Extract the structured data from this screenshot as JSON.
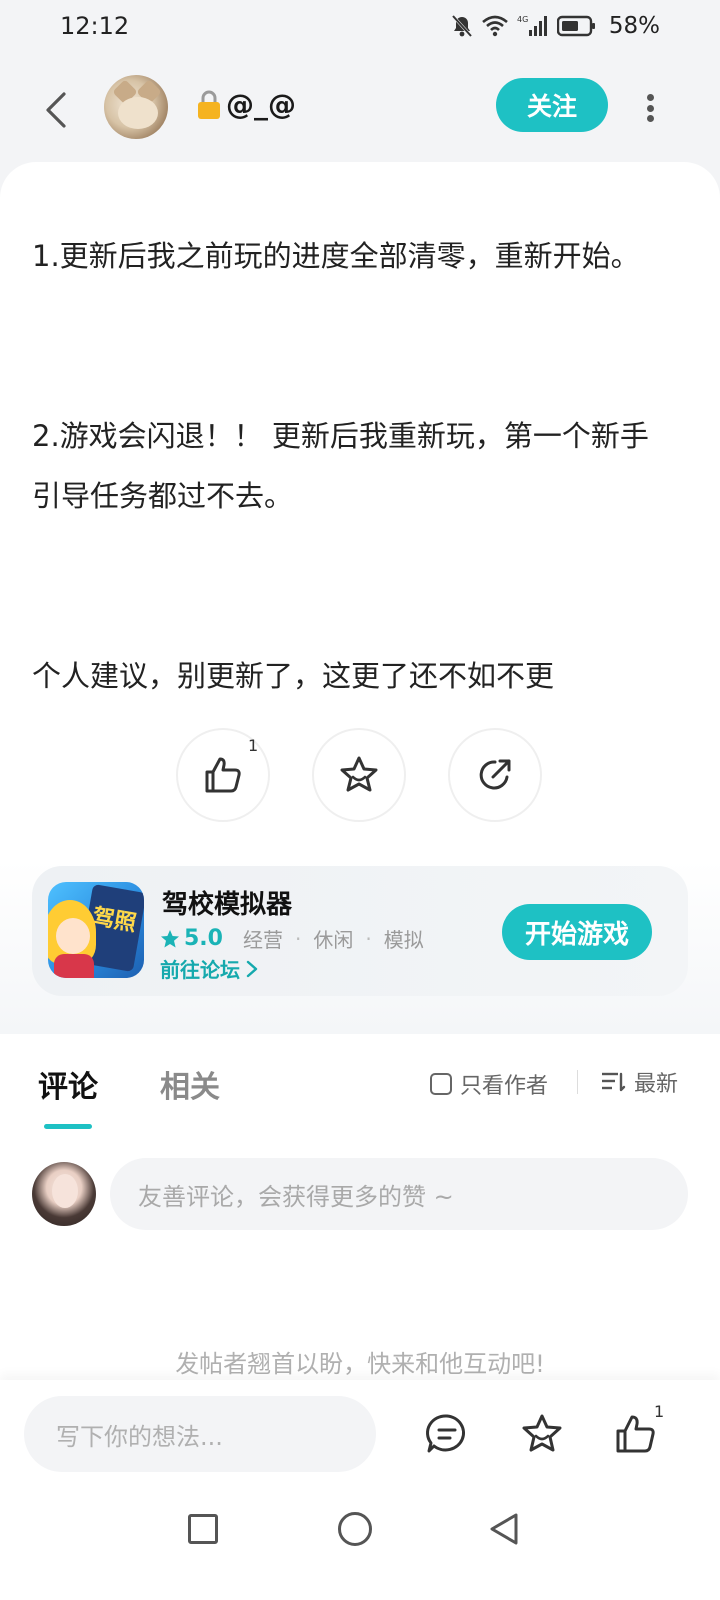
{
  "status_bar": {
    "time": "12:12",
    "battery": "58%"
  },
  "header": {
    "username": "@_@",
    "follow_label": "关注"
  },
  "post": {
    "paragraphs": [
      "1.更新后我之前玩的进度全部清零，重新开始。",
      "2.游戏会闪退！！ 更新后我重新玩，第一个新手引导任务都过不去。",
      "个人建议，别更新了，这更了还不如不更"
    ],
    "like_count": "1"
  },
  "game": {
    "name": "驾校模拟器",
    "rating": "5.0",
    "tags": [
      "经营",
      "休闲",
      "模拟"
    ],
    "forum_link": "前往论坛",
    "play_label": "开始游戏",
    "icon_text": "驾照"
  },
  "comments": {
    "tabs": [
      "评论",
      "相关"
    ],
    "only_author": "只看作者",
    "sort_label": "最新",
    "input_placeholder": "友善评论，会获得更多的赞 ~",
    "empty_hint": "发帖者翘首以盼，快来和他互动吧!"
  },
  "bottom_bar": {
    "input_placeholder": "写下你的想法...",
    "like_count": "1"
  },
  "colors": {
    "accent": "#1ec1c4",
    "accent_text": "#15a9ad"
  }
}
